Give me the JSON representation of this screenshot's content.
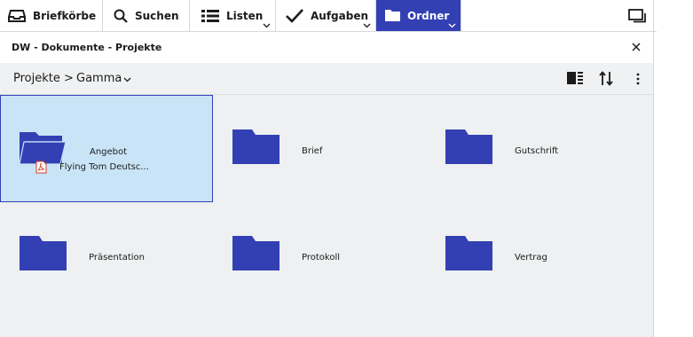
{
  "tabs": [
    {
      "label": "Briefkörbe",
      "icon": "inbox-tray-icon"
    },
    {
      "label": "Suchen",
      "icon": "search-icon"
    },
    {
      "label": "Listen",
      "icon": "list-icon"
    },
    {
      "label": "Aufgaben",
      "icon": "checkmark-icon"
    },
    {
      "label": "Ordner",
      "icon": "folder-icon",
      "active": true
    }
  ],
  "window": {
    "title": "DW - Dokumente - Projekte"
  },
  "breadcrumb": {
    "root": "Projekte",
    "separator": ">",
    "current": "Gamma"
  },
  "folders": [
    {
      "name": "Angebot",
      "open": true,
      "selected": true,
      "child_document": "Flying Tom Deutsc..."
    },
    {
      "name": "Brief"
    },
    {
      "name": "Gutschrift"
    },
    {
      "name": "Präsentation"
    },
    {
      "name": "Protokoll"
    },
    {
      "name": "Vertrag"
    }
  ],
  "colors": {
    "accent": "#3340b3",
    "selection": "#c9e4f7",
    "pdf": "#d83a2b"
  }
}
